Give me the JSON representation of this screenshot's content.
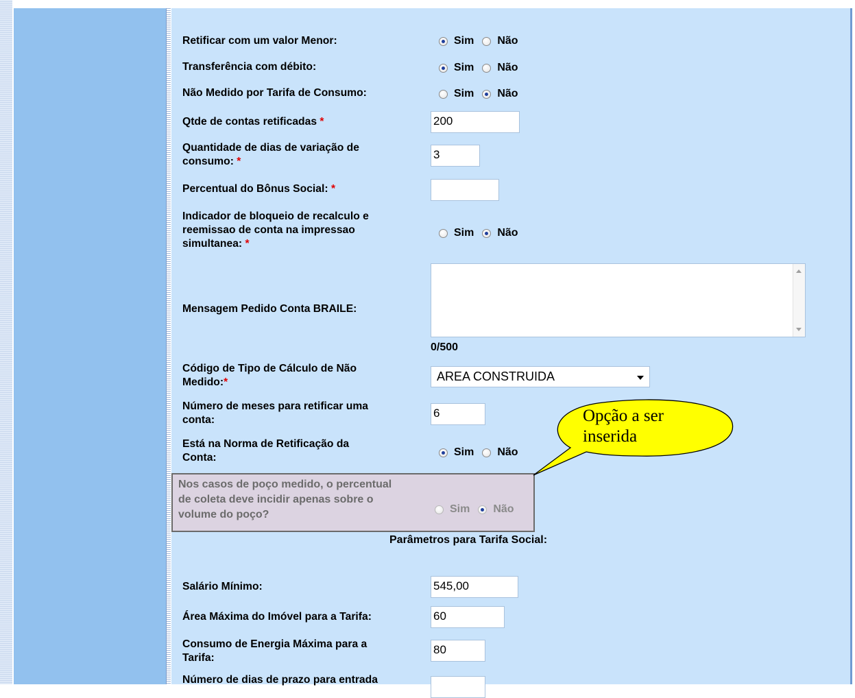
{
  "form": {
    "retificar_menor": {
      "label": "Retificar com um valor Menor:",
      "sim": "Sim",
      "nao": "Não",
      "selected": "Sim"
    },
    "transferencia_debito": {
      "label": "Transferência com débito:",
      "sim": "Sim",
      "nao": "Não",
      "selected": "Sim"
    },
    "nao_medido_tarifa": {
      "label": "Não Medido por Tarifa de Consumo:",
      "sim": "Sim",
      "nao": "Não",
      "selected": "Não"
    },
    "qtde_contas": {
      "label": "Qtde de contas retificadas",
      "value": "200"
    },
    "dias_variacao": {
      "label_line1": "Quantidade de dias de variação de",
      "label_line2": "consumo:",
      "value": "3"
    },
    "bonus_social": {
      "label": "Percentual do Bônus Social:",
      "value": ""
    },
    "bloqueio_recalculo": {
      "label_line1": "Indicador de bloqueio de recalculo e",
      "label_line2": "reemissao de conta na impressao",
      "label_line3": "simultanea:",
      "sim": "Sim",
      "nao": "Não",
      "selected": "Não"
    },
    "mensagem_braile": {
      "label": "Mensagem Pedido Conta BRAILE:",
      "value": "",
      "counter": "0/500"
    },
    "tipo_calculo": {
      "label_line1": "Código de Tipo de Cálculo de Não",
      "label_line2": "Medido:",
      "selected": "AREA CONSTRUIDA"
    },
    "meses_retificar": {
      "label_line1": "Número de meses para retificar uma",
      "label_line2": "conta:",
      "value": "6"
    },
    "norma_retificacao": {
      "label_line1": "Está na Norma de Retificação da",
      "label_line2": "Conta:",
      "sim": "Sim",
      "nao": "Não",
      "selected": "Sim"
    },
    "poco_medido": {
      "label_line1": "Nos casos de poço medido, o percentual",
      "label_line2": "de coleta deve incidir apenas sobre o",
      "label_line3": "volume do poço?",
      "sim": "Sim",
      "nao": "Não",
      "selected": "Não"
    }
  },
  "required_mark": "*",
  "callout": {
    "line1": "Opção a ser",
    "line2": "inserida"
  },
  "tarifa_social": {
    "title": "Parâmetros para Tarifa Social:",
    "salario_minimo": {
      "label": "Salário Mínimo:",
      "value": "545,00"
    },
    "area_maxima": {
      "label": "Área Máxima do Imóvel para a Tarifa:",
      "value": "60"
    },
    "consumo_energia": {
      "label_line1": "Consumo de Energia Máxima para a",
      "label_line2": "Tarifa:",
      "value": "80"
    },
    "dias_prazo": {
      "label": "Número de dias de prazo para entrada"
    }
  },
  "colors": {
    "main_bg": "#c9e3fb",
    "left_panel": "#92c1ee",
    "callout_fill": "#ffff00",
    "highlight_bg": "#dcd3e1",
    "required": "#e00000"
  }
}
